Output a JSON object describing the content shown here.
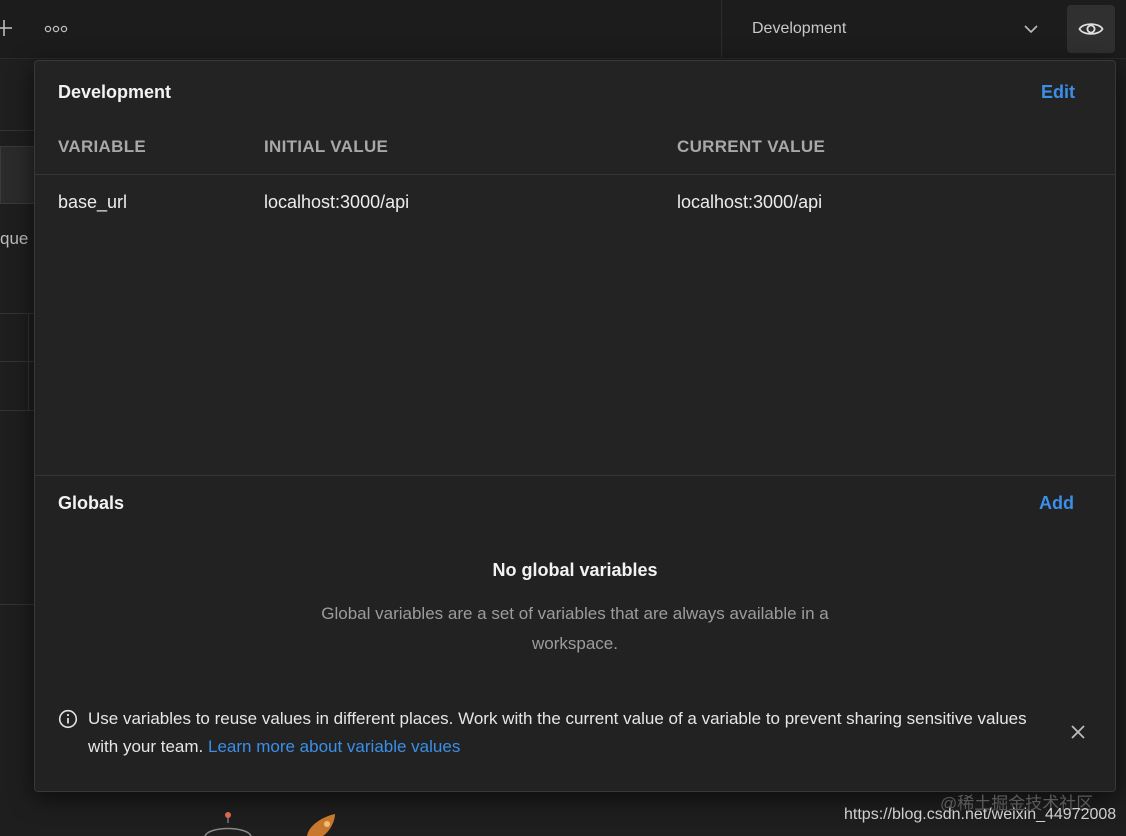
{
  "topbar": {
    "plus_icon": "plus-icon",
    "more_icon": "more-icon",
    "environment_selected": "Development",
    "chevron_icon": "chevron-down-icon",
    "eye_icon": "eye-icon"
  },
  "background": {
    "partial_text": "que"
  },
  "environment": {
    "name": "Development",
    "edit_label": "Edit",
    "columns": {
      "variable": "VARIABLE",
      "initial": "INITIAL VALUE",
      "current": "CURRENT VALUE"
    },
    "rows": [
      {
        "variable": "base_url",
        "initial": "localhost:3000/api",
        "current": "localhost:3000/api"
      }
    ]
  },
  "globals": {
    "title": "Globals",
    "add_label": "Add",
    "empty_title": "No global variables",
    "empty_description": "Global variables are a set of variables that are always available in a workspace."
  },
  "info": {
    "icon": "info-icon",
    "text": "Use variables to reuse values in different places. Work with the current value of a variable to prevent sharing sensitive values with your team.",
    "link": "Learn more about variable values",
    "close_icon": "close-icon"
  },
  "watermark": {
    "cn": "@稀土掘金技术社区",
    "url": "https://blog.csdn.net/weixin_44972008"
  },
  "colors": {
    "accent": "#3a8fe8",
    "panel": "#232323",
    "background": "#1e1e1e"
  }
}
